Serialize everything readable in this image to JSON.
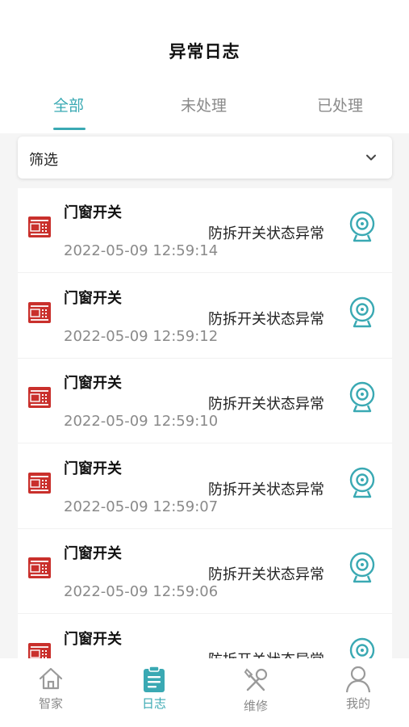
{
  "header": {
    "title": "异常日志"
  },
  "tabs": [
    {
      "label": "全部",
      "active": true
    },
    {
      "label": "未处理",
      "active": false
    },
    {
      "label": "已处理",
      "active": false
    }
  ],
  "filter": {
    "label": "筛选",
    "icon": "chevron-down-icon"
  },
  "colors": {
    "accent": "#3aa9b3",
    "device_icon": "#c9302c",
    "muted": "#8a8a8a"
  },
  "logs": [
    {
      "device": "门窗开关",
      "status": "防拆开关状态异常",
      "time": "2022-05-09 12:59:14"
    },
    {
      "device": "门窗开关",
      "status": "防拆开关状态异常",
      "time": "2022-05-09 12:59:12"
    },
    {
      "device": "门窗开关",
      "status": "防拆开关状态异常",
      "time": "2022-05-09 12:59:10"
    },
    {
      "device": "门窗开关",
      "status": "防拆开关状态异常",
      "time": "2022-05-09 12:59:07"
    },
    {
      "device": "门窗开关",
      "status": "防拆开关状态异常",
      "time": "2022-05-09 12:59:06"
    },
    {
      "device": "门窗开关",
      "status": "防拆开关状态异常",
      "time": ""
    }
  ],
  "nav": [
    {
      "label": "智家",
      "icon": "home-icon",
      "active": false
    },
    {
      "label": "日志",
      "icon": "clipboard-icon",
      "active": true
    },
    {
      "label": "维修",
      "icon": "tools-icon",
      "active": false
    },
    {
      "label": "我的",
      "icon": "person-icon",
      "active": false
    }
  ]
}
